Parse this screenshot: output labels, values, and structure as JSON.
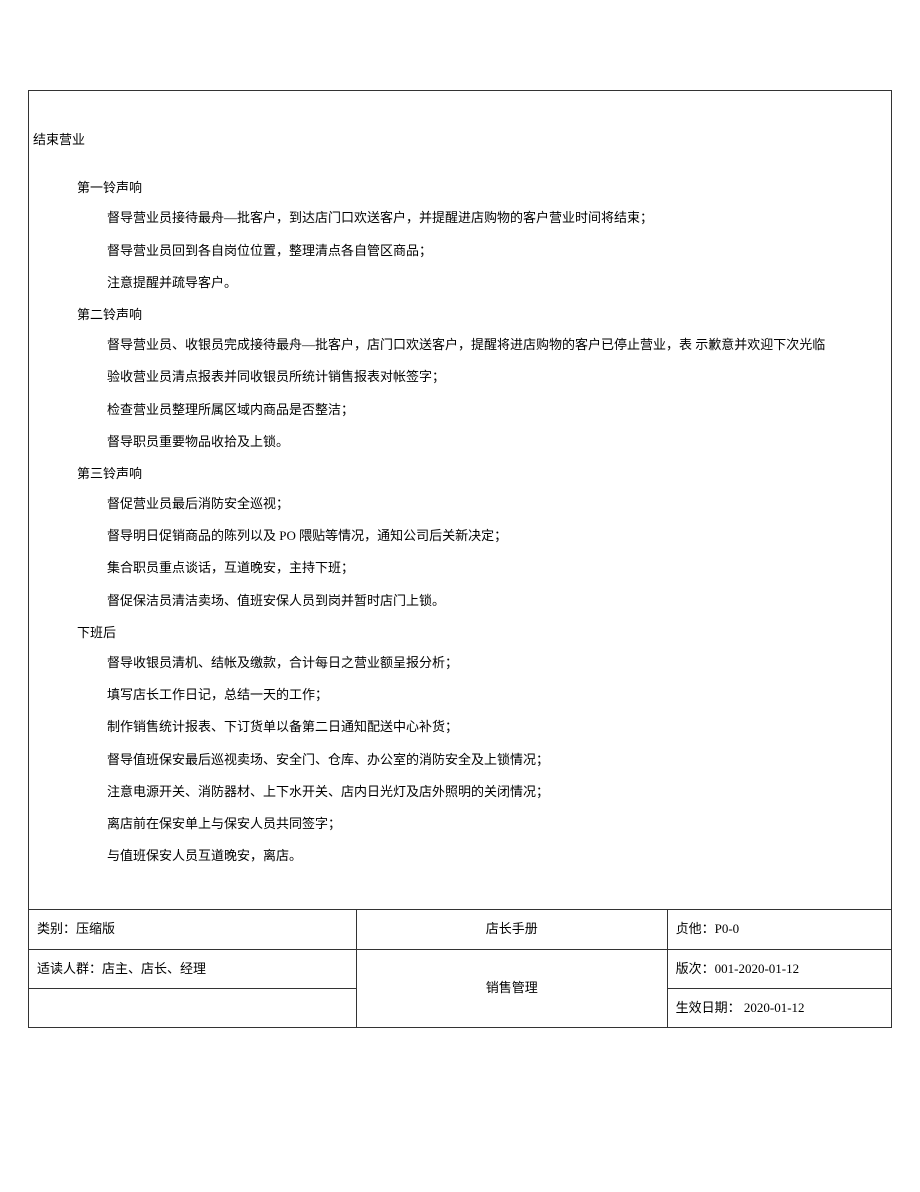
{
  "main": {
    "title": "结束营业",
    "sections": [
      {
        "title": "第一铃声响",
        "items": [
          "督导营业员接待最舟—批客户，到达店门口欢送客户，并提醒进店购物的客户营业时间将结束；",
          "督导营业员回到各自岗位位置，整理清点各自管区商品；",
          "注意提醒并疏导客户。"
        ]
      },
      {
        "title": "第二铃声响",
        "items": [
          "督导营业员、收银员完成接待最舟—批客户，店门口欢送客户，提醒将进店购物的客户已停止营业，表 示歉意并欢迎下次光临",
          "验收营业员清点报表并同收银员所统计销售报表对帐签字；",
          "检查营业员整理所属区域内商品是否整洁；",
          "督导职员重要物品收拾及上锁。"
        ]
      },
      {
        "title": "第三铃声响",
        "items": [
          "督促营业员最后消防安全巡视；",
          "督导明日促销商品的陈列以及 PO 隈贴等情况，通知公司后关新决定；",
          "集合职员重点谈话，互道晚安，主持下班；",
          "督促保洁员清洁卖场、值班安保人员到岗并暂时店门上锁。"
        ]
      },
      {
        "title": "下班后",
        "items": [
          "督导收银员清机、结帐及缴款，合计每日之营业额呈报分析；",
          "填写店长工作日记，总结一天的工作；",
          "制作销售统计报表、下订货单以备第二日通知配送中心补货；",
          "督导值班保安最后巡视卖场、安全门、仓库、办公室的消防安全及上锁情况；",
          "注意电源开关、消防器材、上下水开关、店内日光灯及店外照明的关闭情况；",
          "离店前在保安单上与保安人员共同签字；",
          "与值班保安人员互道晚安，离店。"
        ]
      }
    ]
  },
  "footer": {
    "category": "类别：压缩版",
    "manual_title": "店长手册",
    "page_ref": "贞他：P0-0",
    "audience": "适读人群：店主、店长、经理",
    "subject": "销售管理",
    "edition": "版次：001-2020-01-12",
    "effective_date": "生效日期： 2020-01-12"
  }
}
